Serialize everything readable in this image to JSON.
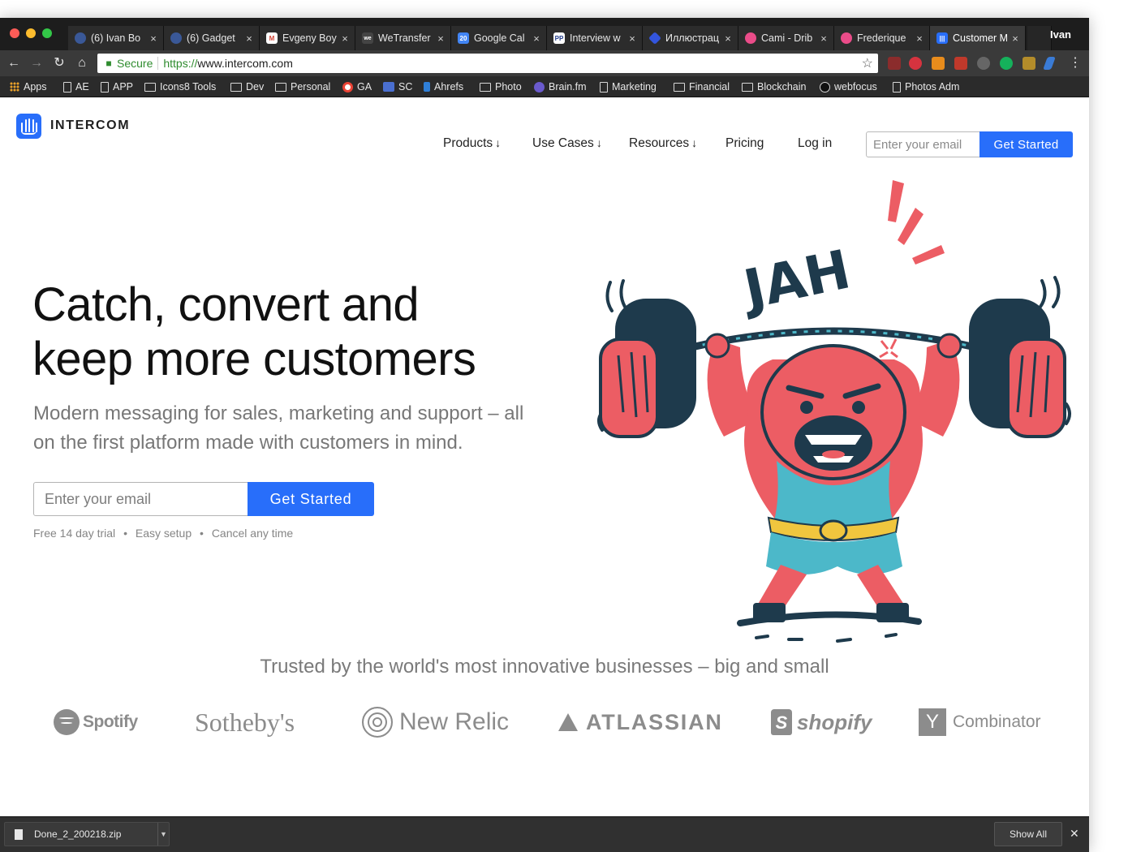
{
  "window": {
    "tabs": [
      {
        "title": "(6) Ivan Bo",
        "favicon_color": "#3a5897"
      },
      {
        "title": "(6) Gadget",
        "favicon_color": "#3a5897"
      },
      {
        "title": "Evgeny Boy",
        "favicon_color": "#d44638"
      },
      {
        "title": "WeTransfer",
        "favicon_color": "#444444"
      },
      {
        "title": "Google Cal",
        "favicon_color": "#4285f4"
      },
      {
        "title": "Interview w",
        "favicon_color": "#ffffff"
      },
      {
        "title": "Иллюстрац",
        "favicon_color": "#3355dd"
      },
      {
        "title": "Cami - Drib",
        "favicon_color": "#ea4c89"
      },
      {
        "title": "Frederique",
        "favicon_color": "#ea4c89"
      },
      {
        "title": "Customer M",
        "favicon_color": "#286efa"
      }
    ],
    "profile_name": "Ivan"
  },
  "address_bar": {
    "secure_label": "Secure",
    "url_scheme": "https://",
    "url_host": "www.intercom.com"
  },
  "bookmarks": [
    {
      "label": "Apps",
      "icon": "apps-grid-icon"
    },
    {
      "label": "AE",
      "icon": "page-icon"
    },
    {
      "label": "APP",
      "icon": "page-icon"
    },
    {
      "label": "Icons8 Tools",
      "icon": "folder-icon"
    },
    {
      "label": "Dev",
      "icon": "folder-icon"
    },
    {
      "label": "Personal",
      "icon": "folder-icon"
    },
    {
      "label": "GA",
      "icon": "google-icon"
    },
    {
      "label": "SC",
      "icon": "search-console-icon"
    },
    {
      "label": "Ahrefs",
      "icon": "ahrefs-icon"
    },
    {
      "label": "Photo",
      "icon": "folder-icon"
    },
    {
      "label": "Brain.fm",
      "icon": "brainfm-icon"
    },
    {
      "label": "Marketing",
      "icon": "page-icon"
    },
    {
      "label": "Financial",
      "icon": "folder-icon"
    },
    {
      "label": "Blockchain",
      "icon": "folder-icon"
    },
    {
      "label": "webfocus",
      "icon": "webfocus-icon"
    },
    {
      "label": "Photos Adm",
      "icon": "page-icon"
    }
  ],
  "header": {
    "logo_text": "INTERCOM",
    "nav": [
      {
        "label": "Products",
        "arrow": "↓"
      },
      {
        "label": "Use Cases",
        "arrow": "↓"
      },
      {
        "label": "Resources",
        "arrow": "↓"
      },
      {
        "label": "Pricing",
        "arrow": ""
      },
      {
        "label": "Log in",
        "arrow": ""
      }
    ],
    "email_placeholder": "Enter your email",
    "cta_label": "Get Started"
  },
  "hero": {
    "title_line1": "Catch, convert and",
    "title_line2": "keep more customers",
    "subtitle_line1": "Modern messaging for sales, marketing and support – all",
    "subtitle_line2": "on the first platform made with customers in mind.",
    "email_placeholder": "Enter your email",
    "cta_label": "Get Started",
    "notes": [
      "Free 14 day trial",
      "Easy setup",
      "Cancel any time"
    ],
    "note_separator": "•",
    "illustration_text": "JAH"
  },
  "trusted": {
    "title": "Trusted by the world's most innovative businesses – big and small",
    "logos": [
      {
        "name": "Spotify",
        "icon": "spotify-icon"
      },
      {
        "name": "Sotheby's",
        "icon": ""
      },
      {
        "name": "New Relic",
        "icon": "new-relic-icon"
      },
      {
        "name": "ATLASSIAN",
        "icon": "atlassian-icon"
      },
      {
        "name": "shopify",
        "icon": "shopify-bag-icon"
      },
      {
        "name": "Combinator",
        "icon": "y-combinator-icon",
        "icon_letter": "Y"
      }
    ]
  },
  "download_shelf": {
    "file_name": "Done_2_200218.zip",
    "show_all_label": "Show All"
  },
  "colors": {
    "brand_blue": "#286efa",
    "illustration_red": "#ec5d64",
    "illustration_navy": "#1e3a4c",
    "illustration_teal": "#4cb8c9",
    "illustration_yellow": "#f0c63e"
  }
}
